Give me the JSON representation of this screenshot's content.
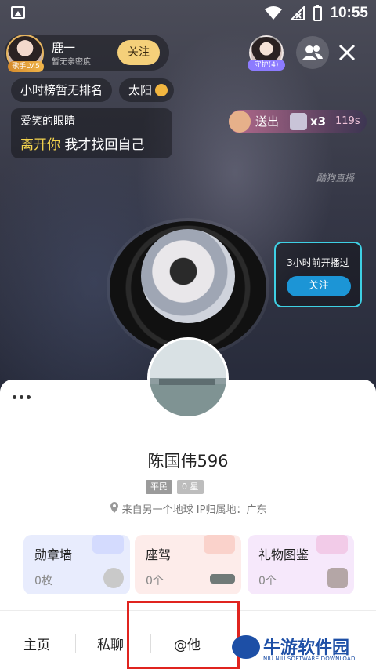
{
  "status_bar": {
    "time": "10:55"
  },
  "host": {
    "name": "鹿一",
    "subtitle": "暂无亲密度",
    "level_badge": "歌手LV.5",
    "follow_label": "关注"
  },
  "guard": {
    "label": "守护(4)"
  },
  "rank_pills": {
    "hour_rank": "小时榜暂无排名",
    "sun_label": "太阳"
  },
  "song": {
    "user": "爱笑的眼睛",
    "highlight": "离开你",
    "rest": " 我才找回自己"
  },
  "gift_bar": {
    "action": "送出",
    "count": "x3",
    "timer": "119s"
  },
  "watermark": "酷狗直播",
  "schedule": {
    "text": "3小时前开播过",
    "button": "关注"
  },
  "profile": {
    "username": "陈国伟596",
    "rank_tag": "平民",
    "stars_tag": "0 星",
    "location_text": "来自另一个地球  IP归属地：广东"
  },
  "cards": [
    {
      "title": "勋章墙",
      "value": "0枚"
    },
    {
      "title": "座驾",
      "value": "0个"
    },
    {
      "title": "礼物图鉴",
      "value": "0个"
    }
  ],
  "bottom_nav": {
    "home": "主页",
    "chat": "私聊",
    "mention": "@他"
  },
  "brand": {
    "name": "牛游软件园",
    "english": "NIU NIU SOFTWARE DOWNLOAD"
  },
  "colors": {
    "follow_button": "#f5d07a",
    "schedule_border": "#3ed0e4",
    "highlight_box": "#e0241f",
    "brand": "#1d4fa6"
  }
}
